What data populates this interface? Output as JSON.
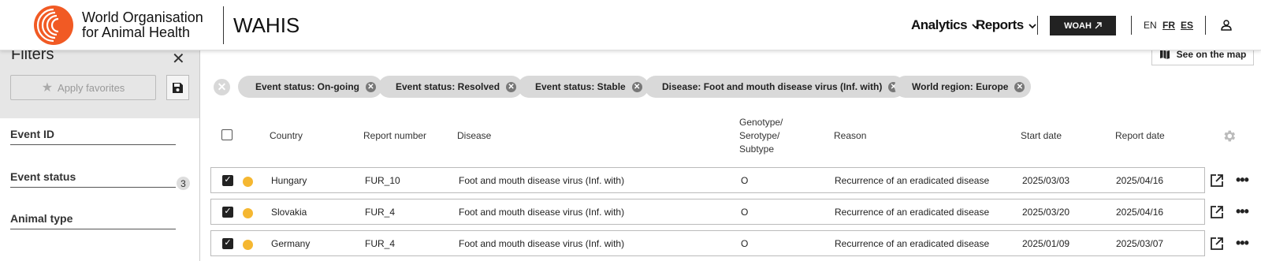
{
  "header": {
    "org_line1": "World Organisation",
    "org_line2": "for Animal Health",
    "app_title": "WAHIS",
    "nav": [
      {
        "label": "Analytics"
      },
      {
        "label": "Reports"
      }
    ],
    "woah_button": "WOAH",
    "languages": [
      {
        "code": "EN",
        "active": false
      },
      {
        "code": "FR",
        "active": true
      },
      {
        "code": "ES",
        "active": true
      }
    ],
    "icons": {
      "user": "user-icon",
      "external": "external-arrow-icon",
      "chevron": "chevron-down-icon"
    }
  },
  "sidebar": {
    "title": "Filters",
    "apply_favorites": "Apply favorites",
    "fields": [
      {
        "label": "Event ID"
      },
      {
        "label": "Event status",
        "count": "3"
      },
      {
        "label": "Animal type"
      }
    ]
  },
  "main": {
    "see_on_map": "See on the map",
    "chips": [
      {
        "label": "Event status: On-going"
      },
      {
        "label": "Event status: Resolved"
      },
      {
        "label": "Event status: Stable"
      },
      {
        "label": "Disease: Foot and mouth disease virus (Inf. with)"
      },
      {
        "label": "World region: Europe"
      }
    ],
    "columns": {
      "country": "Country",
      "report_number": "Report number",
      "disease": "Disease",
      "genotype_1": "Genotype/",
      "genotype_2": "Serotype/",
      "genotype_3": "Subtype",
      "reason": "Reason",
      "start_date": "Start date",
      "report_date": "Report date"
    },
    "rows": [
      {
        "country": "Hungary",
        "report_number": "FUR_10",
        "disease": "Foot and mouth disease virus (Inf. with)",
        "genotype": "O",
        "reason": "Recurrence of an eradicated disease",
        "start_date": "2025/03/03",
        "report_date": "2025/04/16",
        "status_color": "#f5b731"
      },
      {
        "country": "Slovakia",
        "report_number": "FUR_4",
        "disease": "Foot and mouth disease virus (Inf. with)",
        "genotype": "O",
        "reason": "Recurrence of an eradicated disease",
        "start_date": "2025/03/20",
        "report_date": "2025/04/16",
        "status_color": "#f5b731"
      },
      {
        "country": "Germany",
        "report_number": "FUR_4",
        "disease": "Foot and mouth disease virus (Inf. with)",
        "genotype": "O",
        "reason": "Recurrence of an eradicated disease",
        "start_date": "2025/01/09",
        "report_date": "2025/03/07",
        "status_color": "#f5b731"
      }
    ]
  },
  "colors": {
    "brand_orange": "#f15a24",
    "status_ongoing": "#f5b731",
    "dark": "#222222"
  }
}
